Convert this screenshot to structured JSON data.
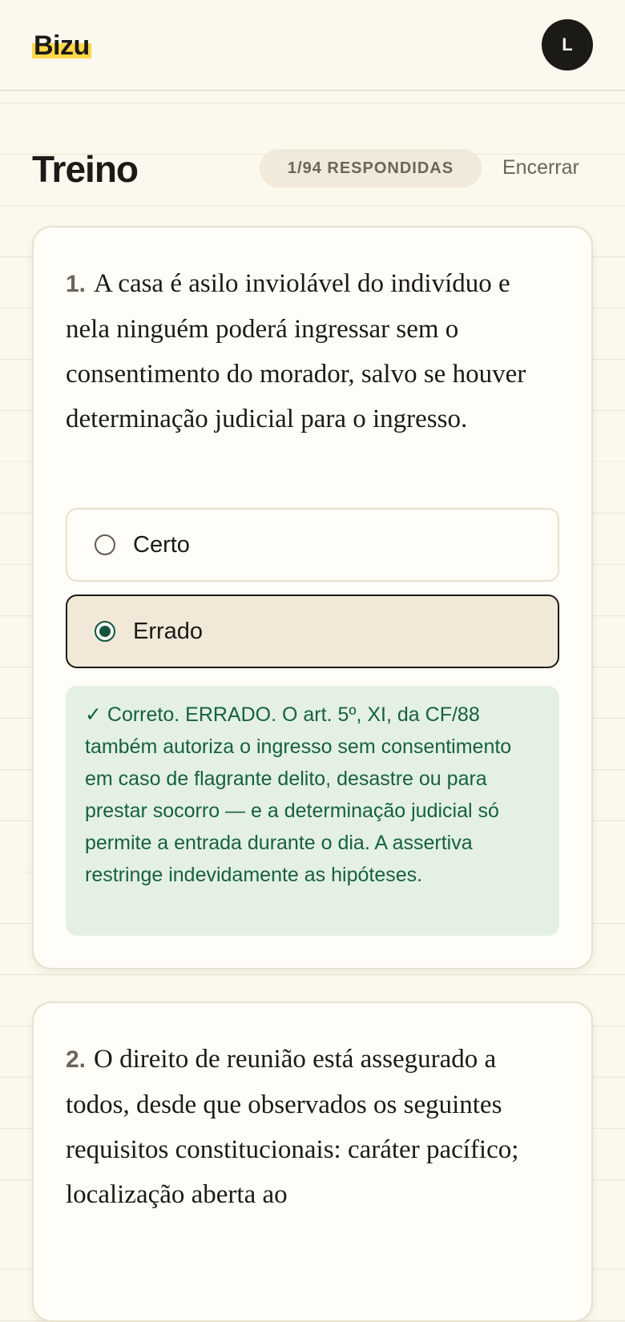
{
  "header": {
    "logo": "Bizu",
    "avatar_initial": "L"
  },
  "page": {
    "title": "Treino",
    "progress": "1/94 RESPONDIDAS",
    "end_label": "Encerrar"
  },
  "questions": [
    {
      "number": "1.",
      "text": "A casa é asilo inviolável do indivíduo e nela ninguém poderá ingressar sem o consentimento do morador, salvo se houver determinação judicial para o ingresso.",
      "options": [
        {
          "label": "Certo",
          "selected": false
        },
        {
          "label": "Errado",
          "selected": true
        }
      ],
      "feedback": "✓ Correto. ERRADO. O art. 5º, XI, da CF/88 também autoriza o ingresso sem consentimento em caso de flagrante delito, desastre ou para prestar socorro — e a determinação judicial só permite a entrada durante o dia. A assertiva restringe indevidamente as hipóteses."
    },
    {
      "number": "2.",
      "text": "O direito de reunião está assegurado a todos, desde que observados os seguintes requisitos constitucionais: caráter pacífico; localização aberta ao"
    }
  ],
  "colors": {
    "background": "#fbf8ee",
    "accent_highlight": "#ffd84a",
    "success_text": "#16613f",
    "success_bg": "#e4f0e4",
    "selected_bg": "#f1e8d8"
  }
}
